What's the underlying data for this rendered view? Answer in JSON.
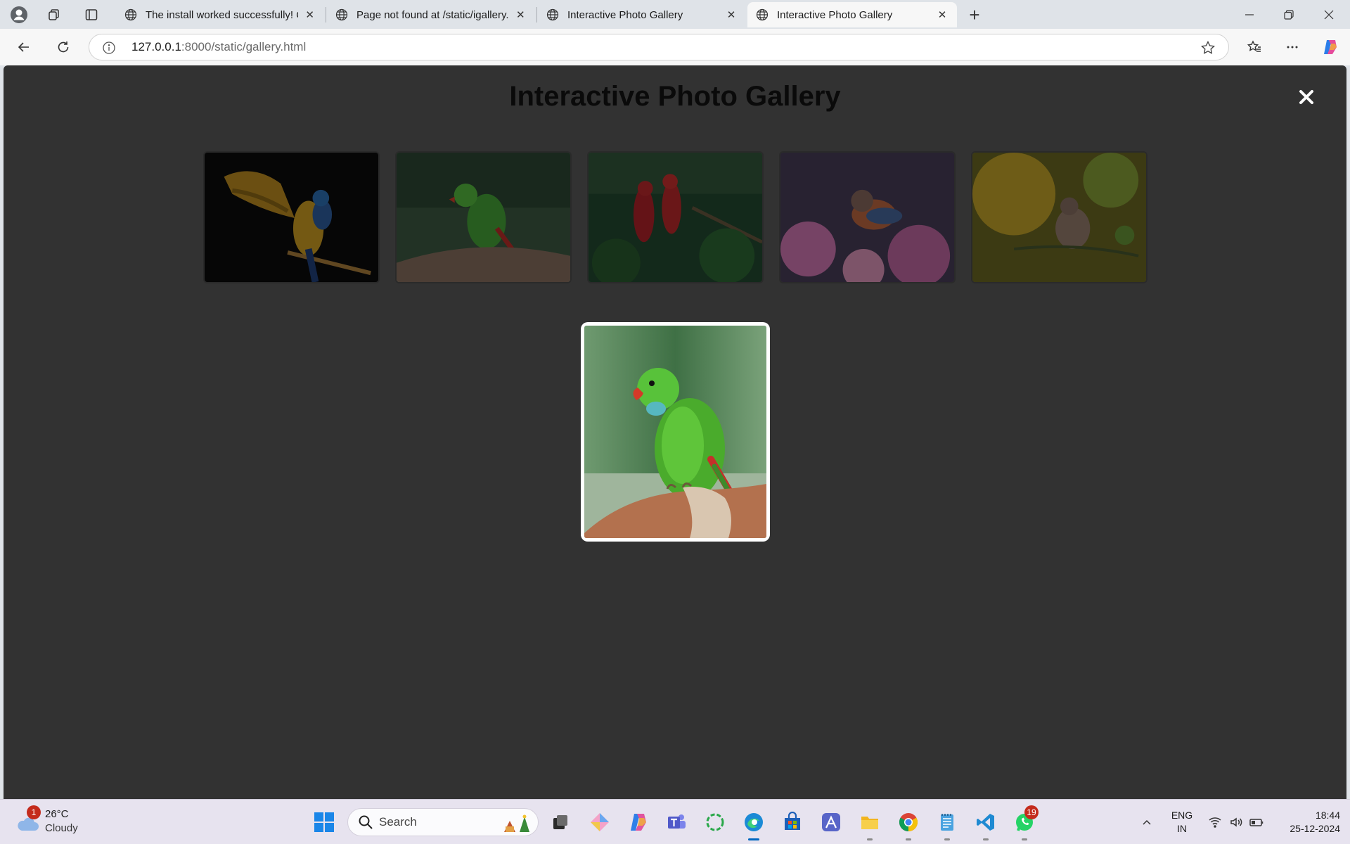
{
  "browser": {
    "tabs": [
      {
        "title": "The install worked successfully! Co",
        "active": false
      },
      {
        "title": "Page not found at /static/igallery.h",
        "active": false
      },
      {
        "title": "Interactive Photo Gallery",
        "active": false
      },
      {
        "title": "Interactive Photo Gallery",
        "active": true
      }
    ],
    "url_host": "127.0.0.1",
    "url_rest": ":8000/static/gallery.html"
  },
  "page": {
    "title": "Interactive Photo Gallery",
    "close_symbol": "✕",
    "thumbnails": [
      {
        "subject": "blue-and-yellow macaw with spread wings",
        "colors": [
          "#0c0c0c",
          "#c99722"
        ]
      },
      {
        "subject": "green parakeet on a branch",
        "colors": [
          "#1f3a26",
          "#58a83c"
        ]
      },
      {
        "subject": "two scarlet macaws among leaves",
        "colors": [
          "#123a2a",
          "#b41e22"
        ]
      },
      {
        "subject": "small bird among pink flowers",
        "colors": [
          "#3a2a40",
          "#d77aa0"
        ]
      },
      {
        "subject": "sparrow on a branch, yellow bokeh",
        "colors": [
          "#6a6a1a",
          "#f0d032"
        ]
      }
    ],
    "lightbox": {
      "subject": "green parakeet on a branch"
    },
    "overlay_color": "#323232"
  },
  "taskbar": {
    "weather": {
      "temp": "26°C",
      "condition": "Cloudy",
      "badge": "1"
    },
    "search_label": "Search",
    "apps": [
      "start-icon",
      "search-icon",
      "task-view-icon",
      "paint-icon",
      "copilot-icon",
      "teams-icon",
      "refresh-app-icon",
      "edge-icon",
      "store-icon",
      "affinity-icon",
      "file-explorer-icon",
      "chrome-icon",
      "notepad-icon",
      "vscode-icon",
      "whatsapp-icon"
    ],
    "whatsapp_badge": "19",
    "language": "ENG",
    "region": "IN",
    "time": "18:44",
    "date": "25-12-2024"
  }
}
